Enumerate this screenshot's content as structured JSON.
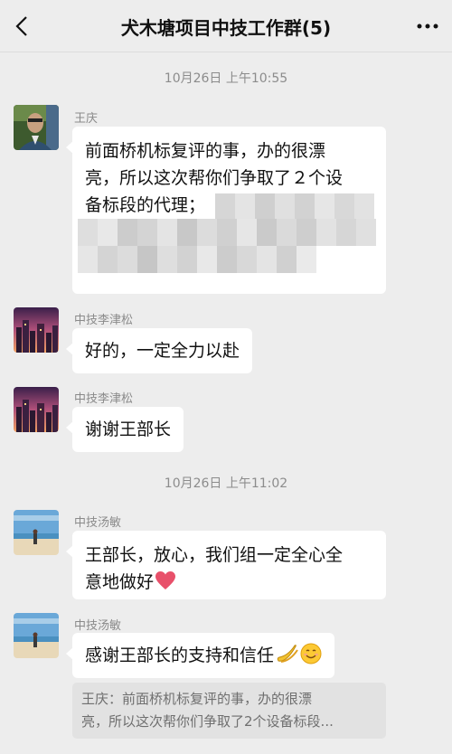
{
  "header": {
    "title": "犬木塘项目中技工作群(5)",
    "back_icon": "chevron-left-icon",
    "more_icon": "more-dots-icon"
  },
  "timestamps": [
    "10月26日 上午10:55",
    "10月26日 上午11:02"
  ],
  "messages": [
    {
      "sender": "王庆",
      "avatar": "avatar-man-photo",
      "line1": "前面桥机标复评的事，办的很漂",
      "line2": "亮，所以这次帮你们争取了２个设",
      "line3": "备标段的代理；",
      "redacted": true
    },
    {
      "sender": "中技李津松",
      "avatar": "avatar-city-sunset",
      "text": "好的，一定全力以赴"
    },
    {
      "sender": "中技李津松",
      "avatar": "avatar-city-sunset",
      "text": "谢谢王部长"
    },
    {
      "sender": "中技汤敏",
      "avatar": "avatar-beach",
      "line1": "王部长，放心，我们组一定全心全",
      "line2": "意地做好",
      "emoji": "heart-emoji"
    },
    {
      "sender": "中技汤敏",
      "avatar": "avatar-beach",
      "text": "感谢王部长的支持和信任",
      "emoji": [
        "banana-emoji",
        "smile-emoji"
      ]
    }
  ],
  "quote": {
    "line1": "王庆：前面桥机标复评的事，办的很漂",
    "line2": "亮，所以这次帮你们争取了2个设备标段..."
  },
  "colors": {
    "background": "#ededed",
    "bubble": "#ffffff",
    "quote_bg": "#e2e2e2",
    "meta_text": "#8c8c8c"
  }
}
